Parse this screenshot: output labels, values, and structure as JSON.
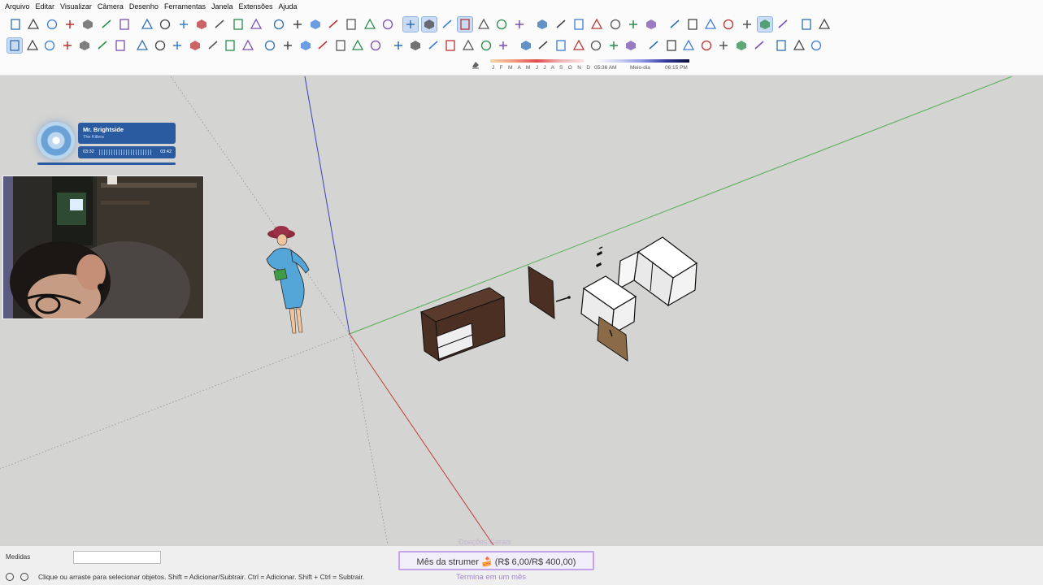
{
  "menu": [
    "Arquivo",
    "Editar",
    "Visualizar",
    "Câmera",
    "Desenho",
    "Ferramentas",
    "Janela",
    "Extensões",
    "Ajuda"
  ],
  "toolbar": {
    "row1_icons": [
      "new-file-icon",
      "open-folder-icon",
      "save-icon",
      "cut-icon",
      "copy-icon",
      "paste-icon",
      "erase-icon",
      "undo-icon",
      "redo-icon",
      "print-icon",
      "model-info-icon",
      "iso-view-icon",
      "top-view-icon",
      "front-view-icon",
      "right-view-icon",
      "back-view-icon",
      "left-view-icon",
      "bottom-view-icon",
      "xray-icon",
      "back-edges-icon",
      "wireframe-icon",
      "hidden-line-icon",
      "shaded-icon",
      "shaded-textures-icon",
      "monochrome-icon",
      "section-plane-icon",
      "display-sections-icon",
      "section-cuts-icon",
      "section-fill-icon",
      "warehouse-icon",
      "extension-warehouse-icon",
      "components-icon",
      "materials-icon",
      "styles-icon",
      "layers-icon",
      "add-location-icon",
      "toggle-terrain-icon",
      "photo-texture-icon",
      "sandbox-icon",
      "cloud-icon",
      "layout-send-icon",
      "info-icon",
      "cart-icon",
      "account-icon"
    ],
    "row2_icons": [
      "select-arrow-icon",
      "lasso-icon",
      "paint-bucket-icon",
      "eraser-icon",
      "line-icon",
      "freehand-icon",
      "rectangle-icon",
      "rotated-rectangle-icon",
      "circle-icon",
      "polygon-icon",
      "arc-icon",
      "two-point-arc-icon",
      "three-point-arc-icon",
      "pie-icon",
      "move-icon",
      "push-pull-icon",
      "rotate-icon",
      "follow-me-icon",
      "scale-icon",
      "offset-icon",
      "tape-measure-icon",
      "dimension-icon",
      "protractor-icon",
      "text-icon",
      "axes-icon",
      "3d-text-icon",
      "orbit-icon",
      "pan-icon",
      "zoom-icon",
      "zoom-window-icon",
      "zoom-extents-icon",
      "previous-view-icon",
      "position-camera-icon",
      "look-around-icon",
      "walk-icon",
      "outer-shell-icon",
      "intersect-icon",
      "union-icon",
      "subtract-icon",
      "trim-icon",
      "split-icon",
      "solid-tools-icon",
      "soften-icon",
      "dynamic-components-icon",
      "options-icon"
    ],
    "active": [
      "select-arrow-icon",
      "hidden-line-icon",
      "shaded-icon",
      "monochrome-icon",
      "layout-send-icon"
    ]
  },
  "shadows": {
    "months": "J F M A M J J A S O N D",
    "time_start": "05:36 AM",
    "time_mid": "Meio-dia",
    "time_end": "06:15 PM"
  },
  "music": {
    "song": "Mr. Brightside",
    "artist": "The Killers",
    "elapsed": "03:32",
    "duration": "03:42"
  },
  "statusbar": {
    "measure_label": "Medidas",
    "measure_value": "",
    "hint": "Clique ou arraste para selecionar objetos. Shift = Adicionar/Subtrair. Ctrl = Adicionar. Shift + Ctrl = Subtrair."
  },
  "goal": {
    "top": "Doações Gerais",
    "text": "Mês da strumer 🍰 (R$ 6,00/R$ 400,00)",
    "bottom": "Termina em um mês"
  },
  "colors": {
    "axis_x": "#c43a3a",
    "axis_y": "#53b04f",
    "axis_z": "#3f3fbd",
    "wood_dark": "#4b2f23",
    "wood_light": "#8a6a47"
  }
}
